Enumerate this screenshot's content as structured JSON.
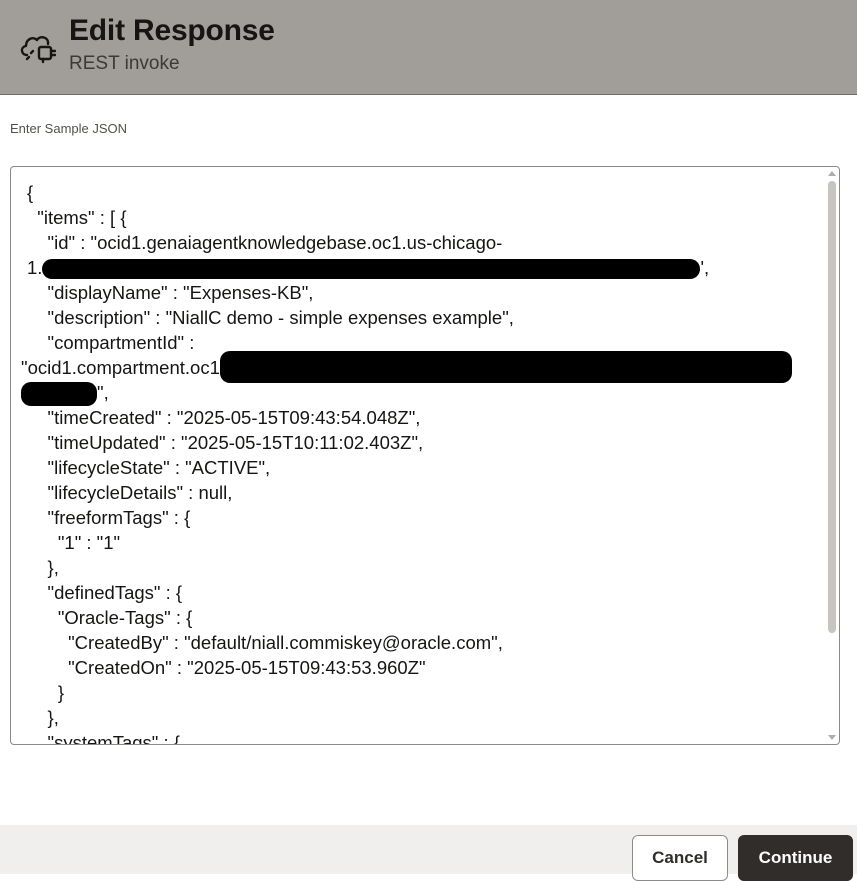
{
  "header": {
    "title": "Edit Response",
    "subtitle": "REST invoke",
    "icon": "cloud-plug-icon"
  },
  "form": {
    "label": "Enter Sample JSON"
  },
  "json_lines": [
    "{",
    "  \"items\" : [ {",
    "    \"id\" : \"ocid1.genaiagentknowledgebase.oc1.us-chicago-",
    "1.",
    "    \"displayName\" : \"Expenses-KB\",",
    "    \"description\" : \"NiallC demo - simple expenses example\",",
    "    \"compartmentId\" :",
    "\"ocid1.compartment.oc1",
    "\",",
    "    \"timeCreated\" : \"2025-05-15T09:43:54.048Z\",",
    "    \"timeUpdated\" : \"2025-05-15T10:11:02.403Z\",",
    "    \"lifecycleState\" : \"ACTIVE\",",
    "    \"lifecycleDetails\" : null,",
    "    \"freeformTags\" : {",
    "      \"1\" : \"1\"",
    "    },",
    "    \"definedTags\" : {",
    "      \"Oracle-Tags\" : {",
    "        \"CreatedBy\" : \"default/niall.commiskey@oracle.com\",",
    "        \"CreatedOn\" : \"2025-05-15T09:43:53.960Z\"",
    "      }",
    "    },",
    "    \"systemTags\" : {"
  ],
  "redacted_suffix": "',",
  "buttons": {
    "cancel": "Cancel",
    "continue": "Continue"
  }
}
